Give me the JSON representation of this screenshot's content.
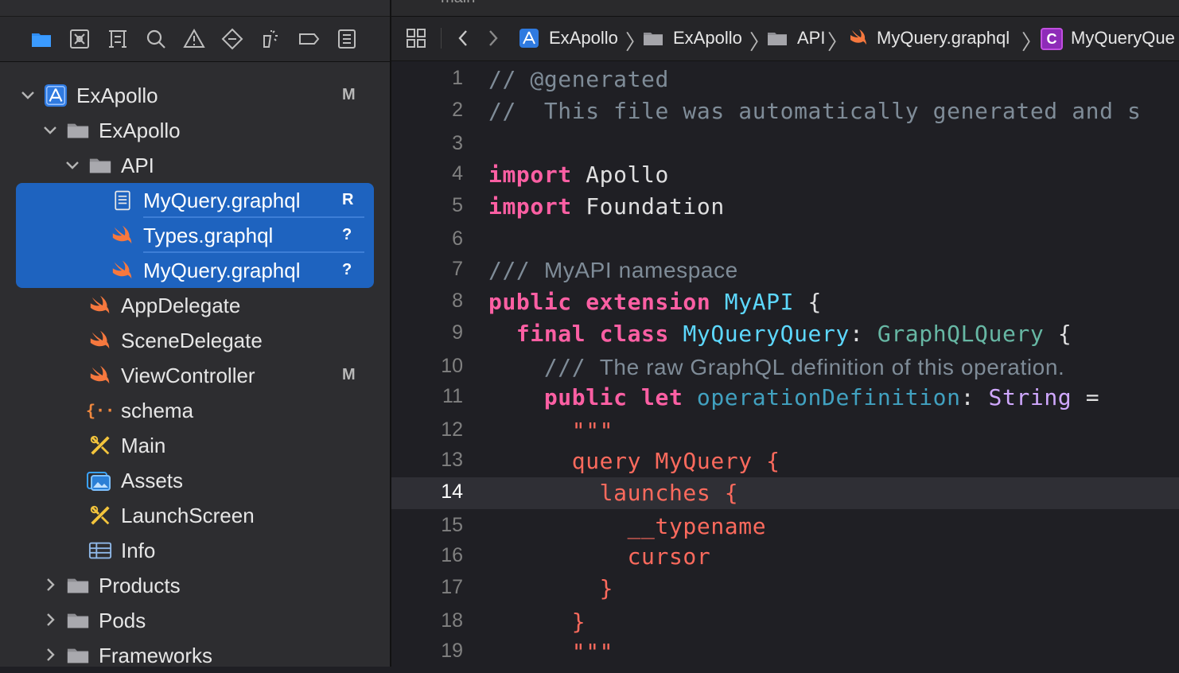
{
  "navigator": {
    "toolbar": [
      {
        "name": "project-navigator-icon"
      },
      {
        "name": "source-control-navigator-icon"
      },
      {
        "name": "symbol-navigator-icon"
      },
      {
        "name": "find-navigator-icon"
      },
      {
        "name": "issue-navigator-icon"
      },
      {
        "name": "test-navigator-icon"
      },
      {
        "name": "debug-navigator-icon"
      },
      {
        "name": "breakpoint-navigator-icon"
      },
      {
        "name": "report-navigator-icon"
      }
    ],
    "tree": [
      {
        "label": "ExApollo",
        "badge": "M",
        "icon": "app-project-icon",
        "disclosure": "open"
      },
      {
        "label": "ExApollo",
        "badge": "",
        "icon": "folder-icon",
        "disclosure": "open"
      },
      {
        "label": "API",
        "badge": "",
        "icon": "folder-icon",
        "disclosure": "open"
      },
      {
        "label": "MyQuery.graphql",
        "badge": "R",
        "icon": "document-icon",
        "selected": true
      },
      {
        "label": "Types.graphql",
        "badge": "?",
        "icon": "swift-icon",
        "selected": true
      },
      {
        "label": "MyQuery.graphql",
        "badge": "?",
        "icon": "swift-icon",
        "selected": true
      },
      {
        "label": "AppDelegate",
        "badge": "",
        "icon": "swift-icon"
      },
      {
        "label": "SceneDelegate",
        "badge": "",
        "icon": "swift-icon"
      },
      {
        "label": "ViewController",
        "badge": "M",
        "icon": "swift-icon"
      },
      {
        "label": "schema",
        "badge": "",
        "icon": "json-icon"
      },
      {
        "label": "Main",
        "badge": "",
        "icon": "storyboard-icon"
      },
      {
        "label": "Assets",
        "badge": "",
        "icon": "assets-icon"
      },
      {
        "label": "LaunchScreen",
        "badge": "",
        "icon": "storyboard-icon"
      },
      {
        "label": "Info",
        "badge": "",
        "icon": "plist-icon"
      },
      {
        "label": "Products",
        "badge": "",
        "icon": "folder-icon",
        "disclosure": "closed"
      },
      {
        "label": "Pods",
        "badge": "",
        "icon": "folder-icon",
        "disclosure": "closed"
      },
      {
        "label": "Frameworks",
        "badge": "",
        "icon": "folder-icon",
        "disclosure": "closed"
      }
    ]
  },
  "editor": {
    "tab_label": "main",
    "jumpbar": {
      "items": [
        "ExApollo",
        "ExApollo",
        "API",
        "MyQuery.graphql",
        "MyQueryQue"
      ],
      "class_badge": "C"
    },
    "current_line": 14,
    "lines": [
      {
        "n": "1",
        "tokens": [
          [
            "c-comment",
            "// @generated"
          ]
        ]
      },
      {
        "n": "2",
        "tokens": [
          [
            "c-comment",
            "//  This file was automatically generated and s"
          ]
        ]
      },
      {
        "n": "3",
        "tokens": []
      },
      {
        "n": "4",
        "tokens": [
          [
            "c-kw",
            "import"
          ],
          [
            "c-plain",
            " Apollo"
          ]
        ]
      },
      {
        "n": "5",
        "tokens": [
          [
            "c-kw",
            "import"
          ],
          [
            "c-plain",
            " Foundation"
          ]
        ]
      },
      {
        "n": "6",
        "tokens": []
      },
      {
        "n": "7",
        "tokens": [
          [
            "c-comment",
            "/// "
          ],
          [
            "c-doc",
            "MyAPI namespace"
          ]
        ]
      },
      {
        "n": "8",
        "tokens": [
          [
            "c-kw",
            "public extension"
          ],
          [
            "c-plain",
            " "
          ],
          [
            "c-type",
            "MyAPI"
          ],
          [
            "c-plain",
            " {"
          ]
        ]
      },
      {
        "n": "9",
        "tokens": [
          [
            "c-plain",
            "  "
          ],
          [
            "c-kw",
            "final class"
          ],
          [
            "c-plain",
            " "
          ],
          [
            "c-type",
            "MyQueryQuery"
          ],
          [
            "c-plain",
            ": "
          ],
          [
            "c-type2",
            "GraphQLQuery"
          ],
          [
            "c-plain",
            " {"
          ]
        ]
      },
      {
        "n": "10",
        "tokens": [
          [
            "c-plain",
            "    "
          ],
          [
            "c-comment",
            "/// "
          ],
          [
            "c-doc",
            "The raw GraphQL definition of this operation."
          ]
        ]
      },
      {
        "n": "11",
        "tokens": [
          [
            "c-plain",
            "    "
          ],
          [
            "c-kw",
            "public let"
          ],
          [
            "c-plain",
            " "
          ],
          [
            "c-prop",
            "operationDefinition"
          ],
          [
            "c-plain",
            ": "
          ],
          [
            "c-type3",
            "String"
          ],
          [
            "c-plain",
            " ="
          ]
        ]
      },
      {
        "n": "12",
        "tokens": [
          [
            "c-plain",
            "      "
          ],
          [
            "c-str",
            "\"\"\""
          ]
        ]
      },
      {
        "n": "13",
        "tokens": [
          [
            "c-plain",
            "      "
          ],
          [
            "c-str",
            "query MyQuery {"
          ]
        ]
      },
      {
        "n": "14",
        "tokens": [
          [
            "c-plain",
            "        "
          ],
          [
            "c-str",
            "launches {"
          ]
        ]
      },
      {
        "n": "15",
        "tokens": [
          [
            "c-plain",
            "          "
          ],
          [
            "c-str",
            "__typename"
          ]
        ]
      },
      {
        "n": "16",
        "tokens": [
          [
            "c-plain",
            "          "
          ],
          [
            "c-str",
            "cursor"
          ]
        ]
      },
      {
        "n": "17",
        "tokens": [
          [
            "c-plain",
            "        "
          ],
          [
            "c-str",
            "}"
          ]
        ]
      },
      {
        "n": "18",
        "tokens": [
          [
            "c-plain",
            "      "
          ],
          [
            "c-str",
            "}"
          ]
        ]
      },
      {
        "n": "19",
        "tokens": [
          [
            "c-plain",
            "      "
          ],
          [
            "c-str",
            "\"\"\""
          ]
        ]
      }
    ]
  }
}
